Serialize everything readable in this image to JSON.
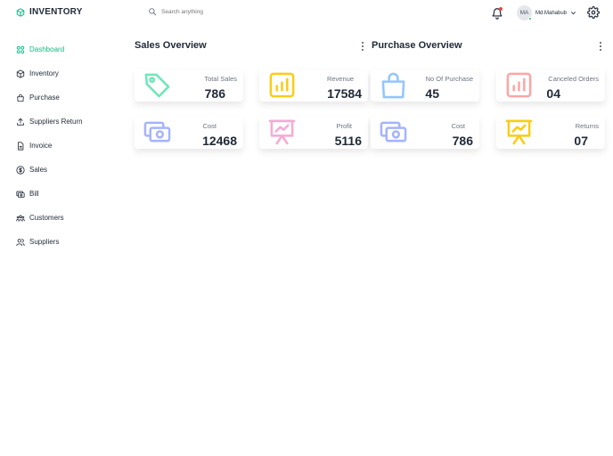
{
  "app": {
    "title": "INVENTORY",
    "accent_color": "#10b981"
  },
  "search": {
    "placeholder": "Search anything"
  },
  "user": {
    "initials": "MA",
    "name": "Md.Mahabub"
  },
  "sidebar": {
    "items": [
      {
        "label": "Dashboard",
        "icon": "dashboard-icon",
        "active": true
      },
      {
        "label": "Inventory",
        "icon": "cube-icon"
      },
      {
        "label": "Purchase",
        "icon": "bag-icon"
      },
      {
        "label": "Suppliers Return",
        "icon": "upload-icon"
      },
      {
        "label": "Invoice",
        "icon": "document-icon"
      },
      {
        "label": "Sales",
        "icon": "dollar-icon"
      },
      {
        "label": "Bill",
        "icon": "bill-icon"
      },
      {
        "label": "Customers",
        "icon": "customers-icon"
      },
      {
        "label": "Suppliers",
        "icon": "suppliers-icon"
      }
    ]
  },
  "sales_overview": {
    "title": "Sales Overview",
    "cards": [
      {
        "label": "Total Sales",
        "value": "786",
        "icon": "tag-icon",
        "color": "#6ee7b7"
      },
      {
        "label": "Revenue",
        "value": "17584",
        "icon": "bar-chart-icon",
        "color": "#facc15"
      },
      {
        "label": "Cost",
        "value": "12468",
        "icon": "money-icon",
        "color": "#a5b4fc"
      },
      {
        "label": "Profit",
        "value": "5116",
        "icon": "presentation-icon",
        "color": "#f9a8d4"
      }
    ]
  },
  "purchase_overview": {
    "title": "Purchase Overview",
    "cards": [
      {
        "label": "No Of Purchase",
        "value": "45",
        "icon": "bag-icon",
        "color": "#93c5fd"
      },
      {
        "label": "Canceled Orders",
        "value": "04",
        "icon": "bar-chart-icon",
        "color": "#fca5a5"
      },
      {
        "label": "Cost",
        "value": "786",
        "icon": "money-icon",
        "color": "#a5b4fc"
      },
      {
        "label": "Returns",
        "value": "07",
        "icon": "presentation-icon",
        "color": "#facc15"
      }
    ]
  }
}
